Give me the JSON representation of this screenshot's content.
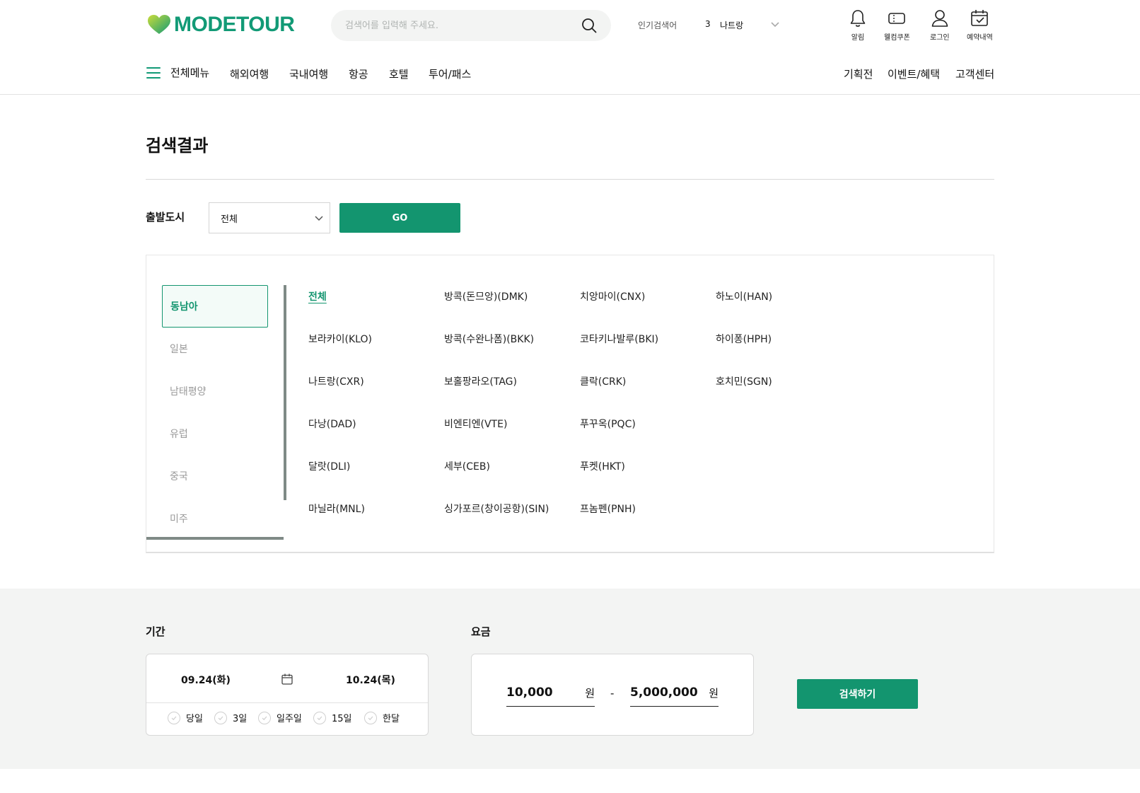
{
  "brand": {
    "name": "MODETOUR",
    "accent": "#129a76",
    "button": "#13956f"
  },
  "search": {
    "placeholder": "검색어를 입력해 주세요."
  },
  "popular": {
    "label": "인기검색어",
    "rank": "3",
    "keyword": "나트랑"
  },
  "utility": {
    "alarm": "알림",
    "coupon": "웰컴쿠폰",
    "login": "로그인",
    "reservations": "예약내역"
  },
  "gnb": {
    "all_menu": "전체메뉴",
    "items": [
      "해외여행",
      "국내여행",
      "항공",
      "호텔",
      "투어/패스"
    ],
    "right_items": [
      "기획전",
      "이벤트/혜택",
      "고객센터"
    ]
  },
  "page": {
    "title": "검색결과"
  },
  "departure": {
    "label": "출발도시",
    "selected": "전체",
    "go_label": "GO"
  },
  "regions": {
    "items": [
      "동남아",
      "일본",
      "남태평양",
      "유럽",
      "중국",
      "미주"
    ],
    "active_index": 0
  },
  "cities": [
    [
      "전체",
      "방콕(돈므앙)(DMK)",
      "치앙마이(CNX)",
      "하노이(HAN)"
    ],
    [
      "보라카이(KLO)",
      "방콕(수완나폼)(BKK)",
      "코타키나발루(BKI)",
      "하이퐁(HPH)"
    ],
    [
      "나트랑(CXR)",
      "보홀팡라오(TAG)",
      "클락(CRK)",
      "호치민(SGN)"
    ],
    [
      "다낭(DAD)",
      "비엔티엔(VTE)",
      "푸꾸옥(PQC)",
      ""
    ],
    [
      "달랏(DLI)",
      "세부(CEB)",
      "푸켓(HKT)",
      ""
    ],
    [
      "마닐라(MNL)",
      "싱가포르(창이공항)(SIN)",
      "프놈펜(PNH)",
      ""
    ]
  ],
  "period": {
    "label": "기간",
    "start": "09.24(화)",
    "end": "10.24(목)",
    "quick": [
      "당일",
      "3일",
      "일주일",
      "15일",
      "한달"
    ]
  },
  "price": {
    "label": "요금",
    "min": "10,000",
    "max": "5,000,000",
    "unit": "원",
    "separator": "-"
  },
  "submit_label": "검색하기"
}
